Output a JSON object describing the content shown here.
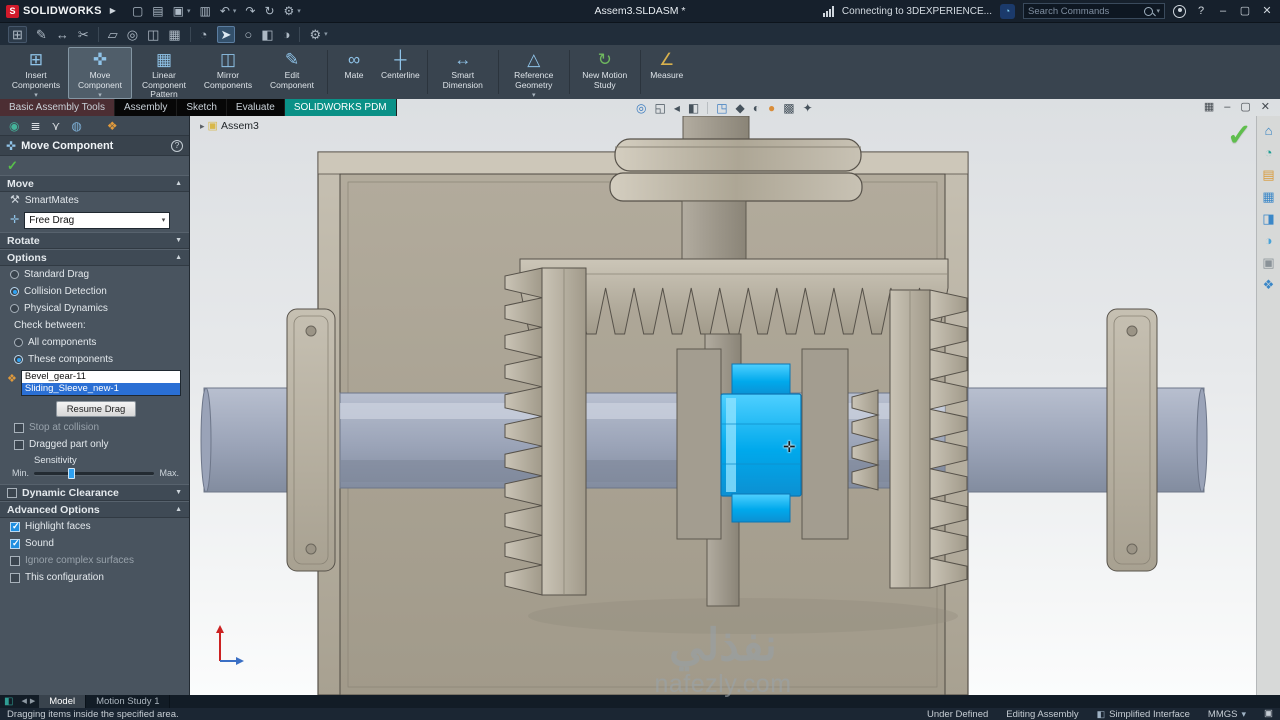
{
  "titlebar": {
    "app_name": "SOLIDWORKS",
    "document_title": "Assem3.SLDASM *",
    "connection_status": "Connecting to 3DEXPERIENCE...",
    "search_placeholder": "Search Commands"
  },
  "icons": {
    "logo_mark": "S",
    "flyout_arrow": "▶",
    "new_doc": "▢",
    "open_doc": "▤",
    "save_doc": "▣",
    "print_doc": "▥",
    "undo": "↶",
    "redo": "↷",
    "rebuild": "↻",
    "gear": "⚙",
    "caret": "▾",
    "minimize": "–",
    "restore": "▢",
    "close": "✕",
    "help": "?",
    "grid_menu": "⊞",
    "sketch": "✎",
    "dimension": "↔",
    "trim": "✂",
    "convert": "▱",
    "offset": "◎",
    "mirror": "◫",
    "pattern": "▦",
    "fillet": "◔",
    "select_arrow": "➤",
    "zoom": "○",
    "section": "◧",
    "appearance_half": "◑",
    "insert_components": "⊞",
    "move_component": "✜",
    "linear_pattern": "▦",
    "mirror_components": "◫",
    "edit_component": "✎",
    "mate": "∞",
    "centerline": "┼",
    "smart_dimension": "↔",
    "reference_geometry": "△",
    "motion_study": "↻",
    "measure": "∠",
    "zoom_fit": "◎",
    "zoom_area": "◱",
    "prev_view": "◂",
    "view_orient": "◳",
    "display_style": "◆",
    "hide_show": "◐",
    "edit_appearance": "●",
    "scene": "▩",
    "view_settings": "✦",
    "viewport_layout": "▦",
    "home": "⌂",
    "xp": "◔",
    "design_lib": "▤",
    "file_exp": "▦",
    "view_palette": "◨",
    "appearances": "◑",
    "custom_prop": "▣",
    "forum": "❖",
    "pm_tab": "◉",
    "fm_tab": "≣",
    "cfg_tab": "⋎",
    "disp_tab": "◍",
    "app_tab": "❖",
    "move_comp": "✜",
    "smartmates": "⚒",
    "free_drag": "✛",
    "comp_list": "❖",
    "ok_check": "✓",
    "chev_up": "▲",
    "chev_down": "▼",
    "tree_expand": "▸",
    "tree_icon": "▣",
    "nav_left": "◀",
    "nav_right": "▶",
    "resources": "◧",
    "green_check": "✓",
    "status_tag": "▣",
    "cursor_move": "✛"
  },
  "ribbon": {
    "buttons": [
      {
        "label": "Insert Components"
      },
      {
        "label": "Move Component"
      },
      {
        "label": "Linear Component Pattern"
      },
      {
        "label": "Mirror Components"
      },
      {
        "label": "Edit Component"
      },
      {
        "label": "Mate"
      },
      {
        "label": "Centerline"
      },
      {
        "label": "Smart Dimension"
      },
      {
        "label": "Reference Geometry"
      },
      {
        "label": "New Motion Study"
      },
      {
        "label": "Measure"
      }
    ]
  },
  "command_tabs": {
    "tabs": [
      {
        "label": "Basic Assembly Tools"
      },
      {
        "label": "Assembly"
      },
      {
        "label": "Sketch"
      },
      {
        "label": "Evaluate"
      },
      {
        "label": "SOLIDWORKS PDM"
      }
    ]
  },
  "property_manager": {
    "title": "Move Component",
    "move_section": {
      "title": "Move",
      "smartmates": "SmartMates",
      "drag_mode": "Free Drag"
    },
    "rotate_section": {
      "title": "Rotate"
    },
    "options_section": {
      "title": "Options",
      "standard_drag": "Standard Drag",
      "collision_detection": "Collision Detection",
      "physical_dynamics": "Physical Dynamics",
      "check_between": "Check between:",
      "all_components": "All components",
      "these_components": "These components",
      "component_1": "Bevel_gear-11",
      "component_2": "Sliding_Sleeve_new-1",
      "resume_drag": "Resume Drag",
      "stop_at_collision": "Stop at collision",
      "dragged_part_only": "Dragged part only",
      "sensitivity": "Sensitivity",
      "min": "Min.",
      "max": "Max."
    },
    "dynamic_clearance_section": {
      "title": "Dynamic Clearance"
    },
    "advanced_section": {
      "title": "Advanced Options",
      "highlight_faces": "Highlight faces",
      "sound": "Sound",
      "ignore_complex_surfaces": "Ignore complex surfaces",
      "this_configuration": "This configuration"
    }
  },
  "viewport": {
    "tree_root": "Assem3",
    "watermark_title": "نفذلي",
    "watermark_subtitle": "nafezly.com"
  },
  "model_tabs": {
    "model": "Model",
    "motion_study": "Motion Study 1"
  },
  "statusbar": {
    "hint": "Dragging items inside the specified area.",
    "under_defined": "Under Defined",
    "editing": "Editing Assembly",
    "simplified": "Simplified Interface",
    "units": "MMGS"
  },
  "colors": {
    "accent_blue": "#2da0f0",
    "selection_blue": "#2a6fd4",
    "sleeve_cyan": "#00a9ec",
    "housing_tan": "#b3ac9d",
    "pdm_teal": "#0a9187"
  }
}
